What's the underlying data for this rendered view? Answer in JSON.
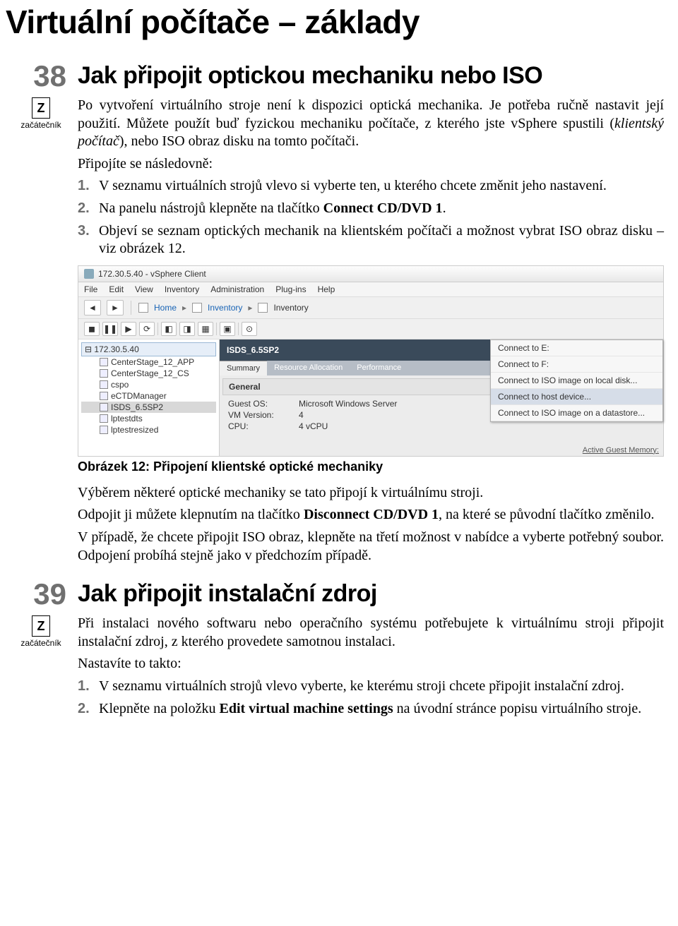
{
  "page_header": "Virtuální počítače – základy",
  "level": {
    "letter": "Z",
    "label": "začátečník"
  },
  "tip38": {
    "number": "38",
    "title": "Jak připojit optickou mechaniku nebo ISO",
    "intro1_a": "Po vytvoření virtuálního stroje není k dispozici optická mechanika. Je potřeba ručně nastavit její použití. Můžete použít buď fyzickou mechaniku počítače, z kterého jste vSphere spustili (",
    "intro1_italic": "klientský počítač",
    "intro1_b": "), nebo ISO obraz disku na tomto počítači.",
    "intro2": "Připojíte se následovně:",
    "steps": [
      "V seznamu virtuálních strojů vlevo si vyberte ten, u kterého chcete změnit jeho nastavení.",
      {
        "a": "Na panelu nástrojů klepněte na tlačítko ",
        "b": "Connect CD/DVD 1",
        "c": "."
      },
      "Objeví se seznam optických mechanik na klientském počítači a možnost vybrat ISO obraz disku – viz obrázek 12."
    ],
    "figure_caption": "Obrázek 12: Připojení klientské optické mechaniky",
    "after1": "Výběrem některé optické mechaniky se tato připojí k virtuálnímu stroji.",
    "after2_a": "Odpojit ji můžete klepnutím na tlačítko ",
    "after2_b": "Disconnect CD/DVD 1",
    "after2_c": ", na které se původní tlačítko změnilo.",
    "after3": "V případě, že chcete připojit ISO obraz, klepněte na třetí možnost v nabídce a vyberte potřebný soubor. Odpojení probíhá stejně jako v předchozím případě."
  },
  "tip39": {
    "number": "39",
    "title": "Jak připojit instalační zdroj",
    "intro1": "Při instalaci nového softwaru nebo operačního systému potřebujete k virtuálnímu stroji připojit instalační zdroj, z kterého provedete samotnou instalaci.",
    "intro2": "Nastavíte to takto:",
    "steps": [
      "V seznamu virtuálních strojů vlevo vyberte, ke kterému stroji chcete připojit instalační zdroj.",
      {
        "a": "Klepněte na položku ",
        "b": "Edit virtual machine settings",
        "c": " na úvodní stránce popisu virtuálního stroje."
      }
    ]
  },
  "screenshot": {
    "window_title": "172.30.5.40 - vSphere Client",
    "menus": [
      "File",
      "Edit",
      "View",
      "Inventory",
      "Administration",
      "Plug-ins",
      "Help"
    ],
    "breadcrumb": [
      "Home",
      "Inventory",
      "Inventory"
    ],
    "tree_root": "172.30.5.40",
    "tree_items": [
      "CenterStage_12_APP",
      "CenterStage_12_CS",
      "cspo",
      "eCTDManager",
      "ISDS_6.5SP2",
      "lptestdts",
      "lptestresized"
    ],
    "tree_selected_index": 4,
    "vm_name": "ISDS_6.5SP2",
    "cd_button": "CD/DVD Drive 1",
    "tabs": [
      "Summary",
      "Resource Allocation",
      "Performance"
    ],
    "active_tab_index": 0,
    "panel_title": "General",
    "general": [
      {
        "k": "Guest OS:",
        "v": "Microsoft Windows Server"
      },
      {
        "k": "VM Version:",
        "v": "4"
      },
      {
        "k": "CPU:",
        "v": "4 vCPU"
      }
    ],
    "dropdown": [
      "Connect to E:",
      "Connect to F:",
      "Connect to ISO image on local disk...",
      "Connect to host device...",
      "Connect to ISO image on a datastore..."
    ],
    "dropdown_hover_index": 3,
    "active_guest_memory": "Active Guest Memory:"
  }
}
